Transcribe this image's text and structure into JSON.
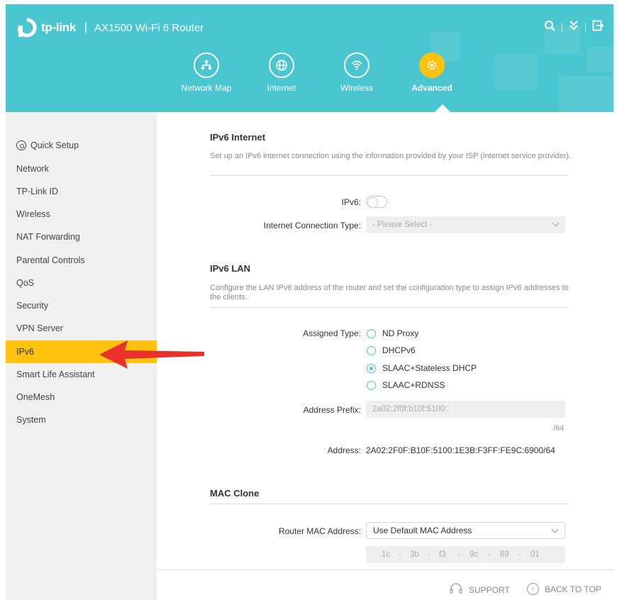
{
  "header": {
    "brand": "tp-link",
    "separator": "|",
    "model": "AX1500 Wi-Fi 6 Router",
    "icons": [
      "search-icon",
      "download-icon",
      "logout-icon"
    ]
  },
  "nav": {
    "items": [
      {
        "label": "Network Map",
        "icon": "network-map-icon"
      },
      {
        "label": "Internet",
        "icon": "globe-icon"
      },
      {
        "label": "Wireless",
        "icon": "wifi-icon"
      },
      {
        "label": "Advanced",
        "icon": "gear-icon",
        "active": true
      }
    ]
  },
  "sidebar": {
    "items": [
      {
        "label": "Quick Setup"
      },
      {
        "label": "Network"
      },
      {
        "label": "TP-Link ID"
      },
      {
        "label": "Wireless"
      },
      {
        "label": "NAT Forwarding"
      },
      {
        "label": "Parental Controls"
      },
      {
        "label": "QoS"
      },
      {
        "label": "Security"
      },
      {
        "label": "VPN Server"
      },
      {
        "label": "IPv6",
        "active": true
      },
      {
        "label": "Smart Life Assistant"
      },
      {
        "label": "OneMesh"
      },
      {
        "label": "System"
      }
    ]
  },
  "ipv6_internet": {
    "title": "IPv6 Internet",
    "description": "Set up an IPv6 internet connection using the information provided by your ISP (internet service provider).",
    "ipv6_label": "IPv6:",
    "ipv6_enabled": false,
    "conn_type_label": "Internet Connection Type:",
    "conn_type_placeholder": "- Please Select -"
  },
  "ipv6_lan": {
    "title": "IPv6 LAN",
    "description": "Configure the LAN IPv6 address of the router and set the configuration type to assign IPv6 addresses to the clients.",
    "assigned_type_label": "Assigned Type:",
    "options": [
      {
        "label": "ND Proxy",
        "checked": false
      },
      {
        "label": "DHCPv6",
        "checked": false
      },
      {
        "label": "SLAAC+Stateless DHCP",
        "checked": true
      },
      {
        "label": "SLAAC+RDNSS",
        "checked": false
      }
    ],
    "prefix_label": "Address Prefix:",
    "prefix_value": "2a02:2f0f:b10f:5100::",
    "prefix_suffix": "/64",
    "address_label": "Address:",
    "address_value": "2A02:2F0F:B10F:5100:1E3B:F3FF:FE9C:6900/64"
  },
  "mac_clone": {
    "title": "MAC Clone",
    "router_mac_label": "Router MAC Address:",
    "router_mac_value": "Use Default MAC Address",
    "mac_segments": [
      "1c",
      "3b",
      "f3",
      "9c",
      "69",
      "01"
    ],
    "mac_sep": "-"
  },
  "footer": {
    "support": "SUPPORT",
    "back_to_top": "BACK TO TOP"
  },
  "colors": {
    "header": "#4ac6d0",
    "accent": "#ffc20e",
    "arrow": "#e8312a"
  }
}
